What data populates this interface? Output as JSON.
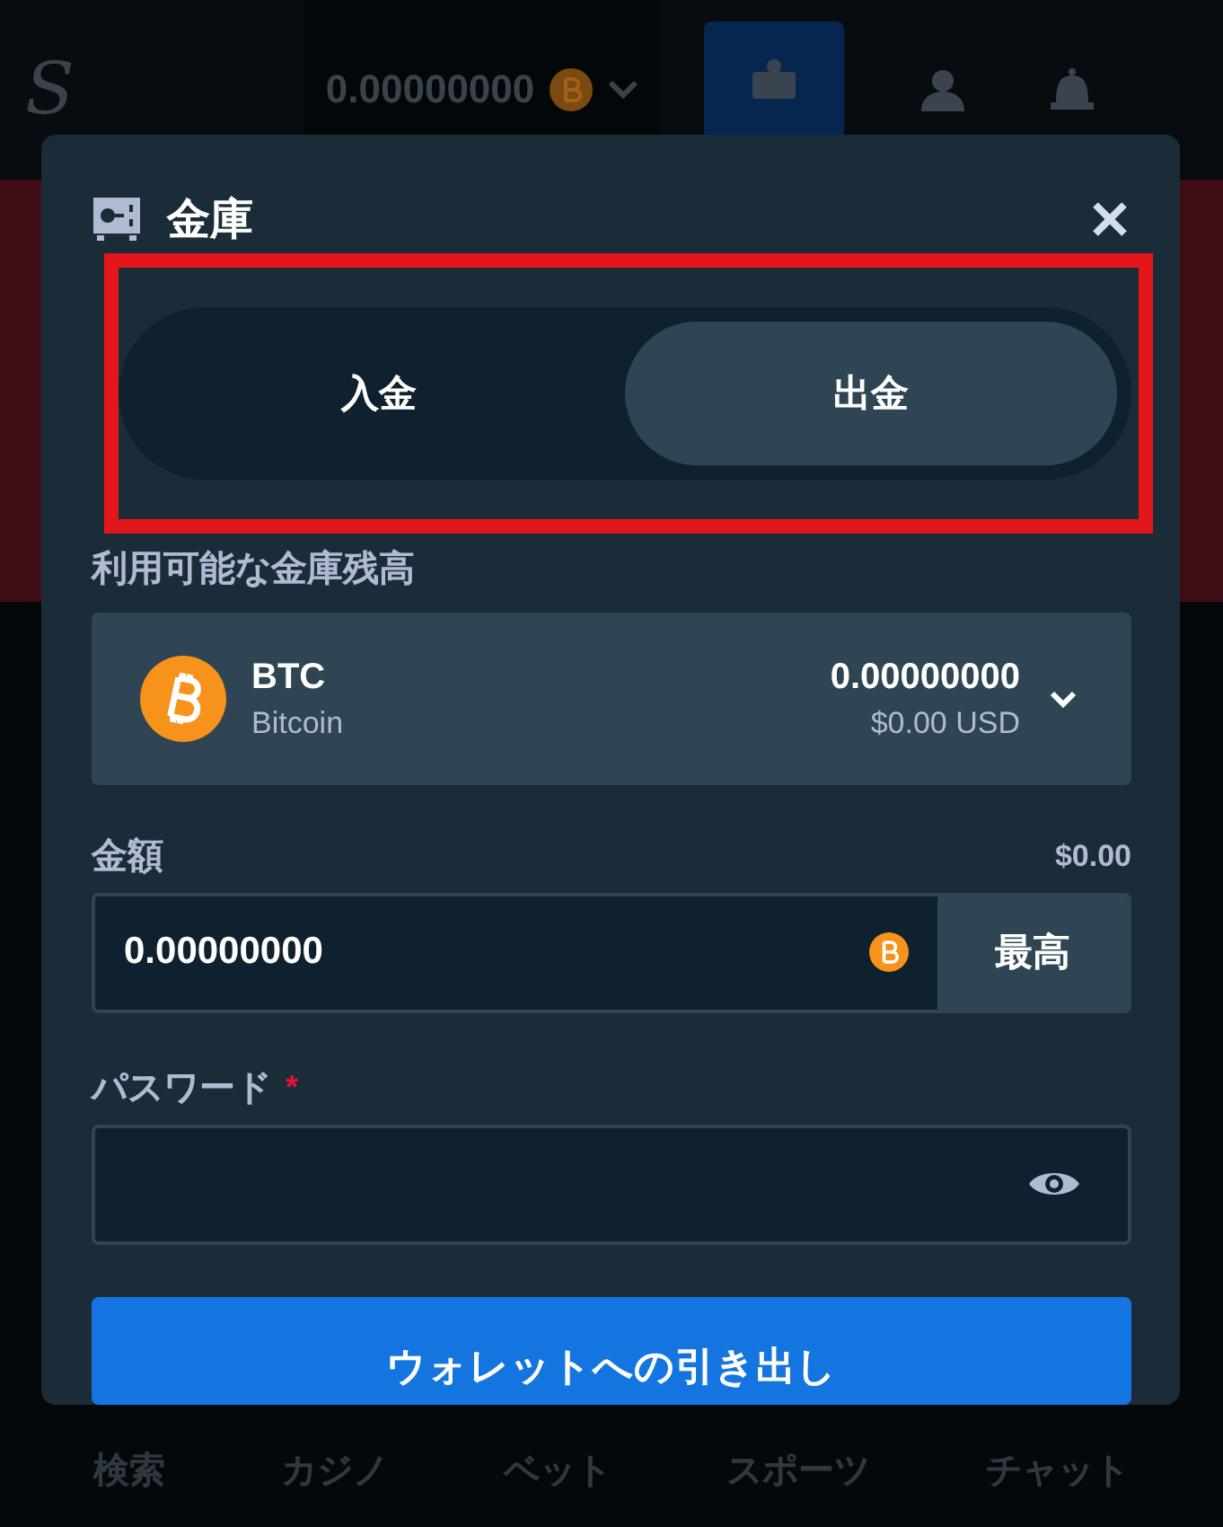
{
  "header": {
    "logo": "S",
    "balance": "0.00000000"
  },
  "vault": {
    "title": "金庫",
    "tabs": [
      {
        "label": "入金",
        "selected": false
      },
      {
        "label": "出金",
        "selected": true
      }
    ],
    "tabs_highlighted": true,
    "balance_label": "利用可能な金庫残高",
    "currency": {
      "code": "BTC",
      "name": "Bitcoin",
      "amount": "0.00000000",
      "usd": "$0.00 USD"
    },
    "amount": {
      "label": "金額",
      "usd": "$0.00",
      "value": "0.00000000",
      "max_button": "最高"
    },
    "password": {
      "label": "パスワード",
      "required_mark": "*"
    },
    "submit_button": "ウォレットへの引き出し"
  },
  "bottom_nav": [
    {
      "label": "検索"
    },
    {
      "label": "カジノ"
    },
    {
      "label": "ベット"
    },
    {
      "label": "スポーツ"
    },
    {
      "label": "チャット"
    }
  ]
}
